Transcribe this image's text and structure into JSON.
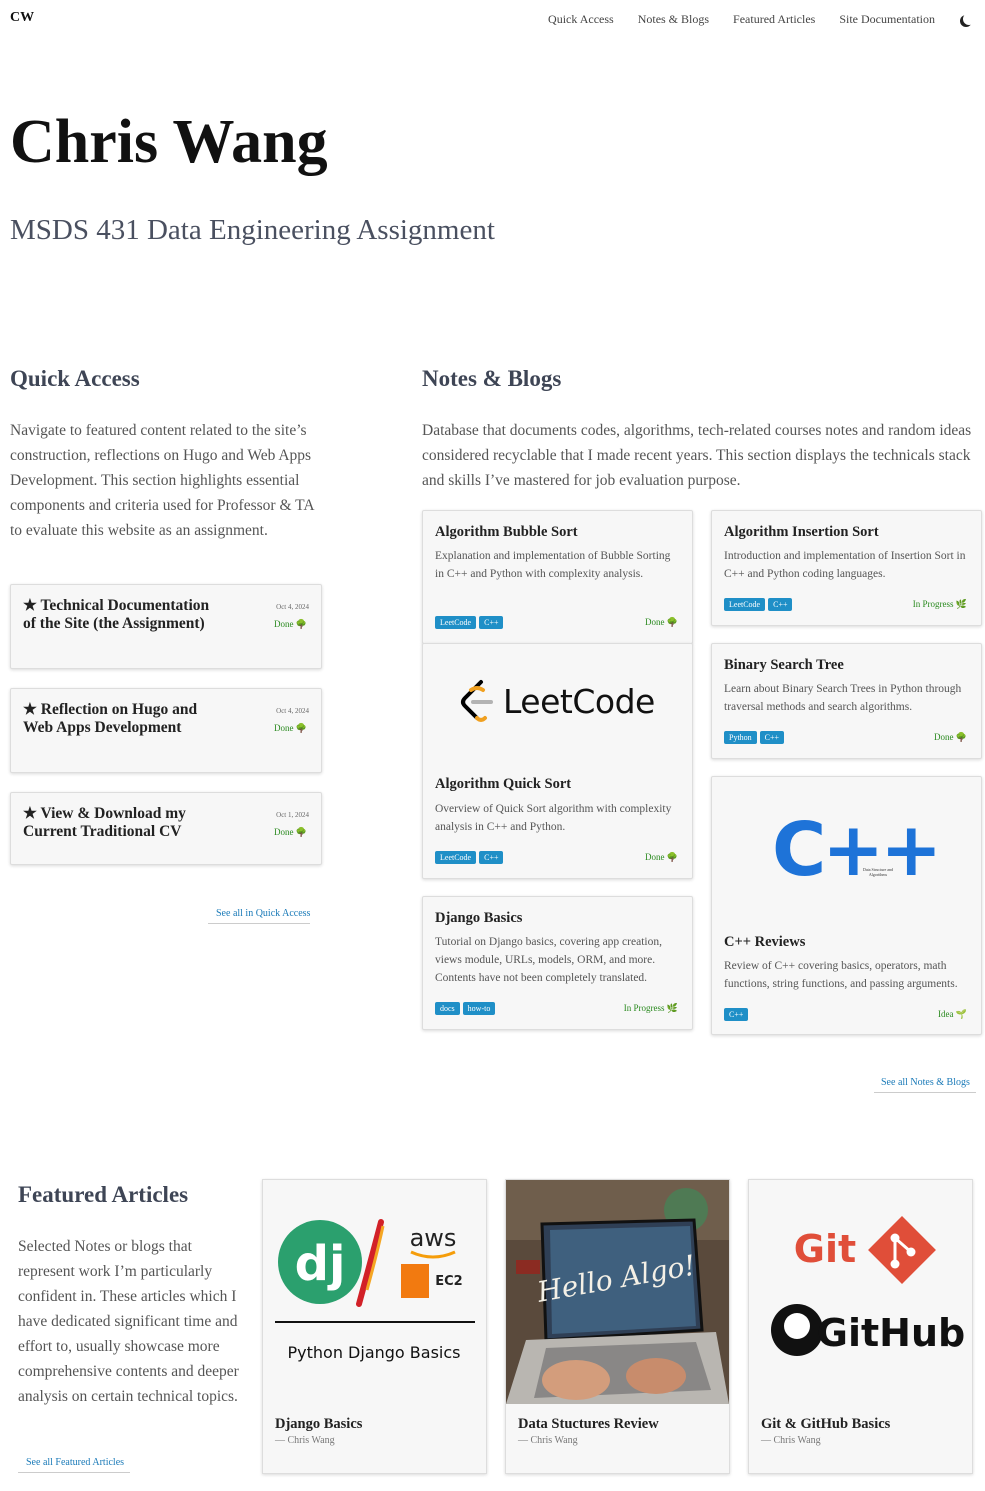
{
  "nav": {
    "logo": "CW",
    "items": [
      "Quick Access",
      "Notes & Blogs",
      "Featured Articles",
      "Site Documentation"
    ],
    "theme_icon": "moon-icon"
  },
  "hero": {
    "title": "Chris Wang",
    "subtitle": "MSDS 431 Data Engineering Assignment"
  },
  "quick_access": {
    "heading": "Quick Access",
    "description": "Navigate to featured content related to the site’s construction, reflections on Hugo and Web Apps Development. This section highlights essential components and criteria used for Professor & TA to evaluate this website as an assignment.",
    "cards": [
      {
        "title": "★ Technical Documentation of the Site (the Assignment)",
        "date": "Oct 4, 2024",
        "status": "Done 🌳"
      },
      {
        "title": "★ Reflection on Hugo and Web Apps Development",
        "date": "Oct 4, 2024",
        "status": "Done 🌳"
      },
      {
        "title": "★ View & Download my Current Traditional CV",
        "date": "Oct 1, 2024",
        "status": "Done 🌳"
      }
    ],
    "see_all": "See all in Quick Access"
  },
  "notes": {
    "heading": "Notes & Blogs",
    "description": "Database that documents codes, algorithms, tech-related courses notes and random ideas considered recyclable that I made recent years. This section displays the technicals stack and skills I’ve mastered for job evaluation purpose.",
    "cards": {
      "bubble": {
        "title": "Algorithm Bubble Sort",
        "desc": "Explanation and implementation of Bubble Sorting in C++ and Python with complexity analysis.",
        "tags": [
          "LeetCode",
          "C++"
        ],
        "status": "Done 🌳"
      },
      "insertion": {
        "title": "Algorithm Insertion Sort",
        "desc": "Introduction and implementation of Insertion Sort in C++ and Python coding languages.",
        "tags": [
          "LeetCode",
          "C++"
        ],
        "status": "In Progress 🌿"
      },
      "quick": {
        "title": "Algorithm Quick Sort",
        "desc": "Overview of Quick Sort algorithm with complexity analysis in C++ and Python.",
        "tags": [
          "LeetCode",
          "C++"
        ],
        "status": "Done 🌳",
        "image_text": "LeetCode"
      },
      "bst": {
        "title": "Binary Search Tree",
        "desc": "Learn about Binary Search Trees in Python through traversal methods and search algorithms.",
        "tags": [
          "Python",
          "C++"
        ],
        "status": "Done 🌳"
      },
      "django": {
        "title": "Django Basics",
        "desc": "Tutorial on Django basics, covering app creation, views module, URLs, models, ORM, and more. Contents have not been completely translated.",
        "tags": [
          "docs",
          "how-to"
        ],
        "status": "In Progress 🌿"
      },
      "cpp": {
        "title": "C++ Reviews",
        "desc": "Review of C++ covering basics, operators, math functions, string functions, and passing arguments.",
        "tags": [
          "C++"
        ],
        "status": "Idea 🌱",
        "image_text": "C++",
        "image_caption": "Data Structure and Algorithms"
      }
    },
    "see_all": "See all Notes & Blogs"
  },
  "featured": {
    "heading": "Featured Articles",
    "description": "Selected Notes or blogs that represent work I’m particularly confident in. These articles which I have dedicated significant time and effort to, usually showcase more comprehensive contents and deeper analysis on certain technical topics.",
    "see_all": "See all Featured Articles",
    "cards": [
      {
        "title": "Django Basics",
        "author": "— Chris Wang",
        "img_caption": "Python Django Basics",
        "img_dj": "dj",
        "img_aws": "aws",
        "img_ec2": "EC2"
      },
      {
        "title": "Data Stuctures Review",
        "author": "— Chris Wang",
        "img_text": "Hello Algo!"
      },
      {
        "title": "Git & GitHub Basics",
        "author": "— Chris Wang",
        "img_git": "Git",
        "img_github": "GitHub"
      }
    ]
  }
}
